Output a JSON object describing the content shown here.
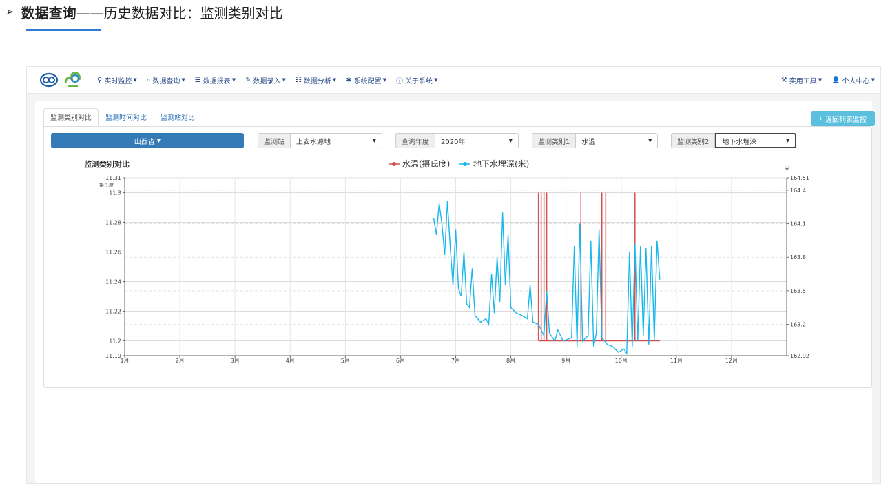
{
  "heading": {
    "arrow": "➢",
    "bold": "数据查询",
    "light": "——历史数据对比：监测类别对比"
  },
  "nav": {
    "items": [
      {
        "icon": "map-marker-icon",
        "glyph": "⚲",
        "label": "实时监控"
      },
      {
        "icon": "search-icon",
        "glyph": "⌕",
        "label": "数据查询"
      },
      {
        "icon": "list-icon",
        "glyph": "☰",
        "label": "数据报表"
      },
      {
        "icon": "edit-icon",
        "glyph": "✎",
        "label": "数据录入"
      },
      {
        "icon": "analysis-icon",
        "glyph": "☷",
        "label": "数据分析"
      },
      {
        "icon": "gear-icon",
        "glyph": "✱",
        "label": "系统配置"
      },
      {
        "icon": "info-icon",
        "glyph": "ⓘ",
        "label": "关于系统"
      }
    ],
    "right": [
      {
        "icon": "wrench-icon",
        "glyph": "⚒",
        "label": "实用工具"
      },
      {
        "icon": "user-icon",
        "glyph": "👤",
        "label": "个人中心"
      }
    ]
  },
  "tabs": [
    "监测类别对比",
    "监测时间对比",
    "监测站对比"
  ],
  "back_button": "返回列表监控",
  "province": "山西省",
  "filters": [
    {
      "label": "监测站",
      "value": "上安水源地"
    },
    {
      "label": "查询年度",
      "value": "2020年"
    },
    {
      "label": "监测类别1",
      "value": "水温"
    },
    {
      "label": "监测类别2",
      "value": "地下水埋深"
    }
  ],
  "colors": {
    "accent": "#337ab7",
    "water_temp": "#d05050",
    "depth": "#19b8ec",
    "back_btn": "#5bc0de"
  },
  "chart_data": {
    "type": "line",
    "title": "监测类别对比",
    "legend": [
      "水温(摄氏度)",
      "地下水埋深(米)"
    ],
    "legend_position": "top-center",
    "ylabel_left": "摄氏度",
    "ylabel_right": "米",
    "x_ticks": [
      "1月",
      "2月",
      "3月",
      "4月",
      "5月",
      "6月",
      "7月",
      "8月",
      "9月",
      "10月",
      "11月",
      "12月"
    ],
    "y_left_ticks": [
      "11.31",
      "11.3",
      "11.28",
      "11.26",
      "11.24",
      "11.22",
      "11.2",
      "11.19"
    ],
    "y_right_ticks": [
      "164.51",
      "164.4",
      "164.1",
      "163.8",
      "163.5",
      "163.2",
      "162.92"
    ],
    "ylim_left": [
      11.19,
      11.31
    ],
    "ylim_right": [
      162.92,
      164.51
    ],
    "grid": true,
    "series": [
      {
        "name": "水温(摄氏度)",
        "baseline": 11.2,
        "range_months": [
          8.5,
          10.7
        ],
        "spikes_month": [
          8.5,
          8.55,
          8.6,
          8.65,
          9.27,
          9.65,
          9.72,
          10.25
        ],
        "spike_value": 11.3
      },
      {
        "name": "地下水埋深(米)",
        "points": [
          [
            6.6,
            164.15
          ],
          [
            6.65,
            164.0
          ],
          [
            6.7,
            164.28
          ],
          [
            6.75,
            164.1
          ],
          [
            6.8,
            163.82
          ],
          [
            6.85,
            164.3
          ],
          [
            6.9,
            163.9
          ],
          [
            6.95,
            163.55
          ],
          [
            7.0,
            164.05
          ],
          [
            7.05,
            163.52
          ],
          [
            7.1,
            163.45
          ],
          [
            7.15,
            163.85
          ],
          [
            7.2,
            163.38
          ],
          [
            7.25,
            163.35
          ],
          [
            7.3,
            163.7
          ],
          [
            7.35,
            163.28
          ],
          [
            7.45,
            163.22
          ],
          [
            7.55,
            163.25
          ],
          [
            7.6,
            163.2
          ],
          [
            7.65,
            163.65
          ],
          [
            7.7,
            163.3
          ],
          [
            7.75,
            163.8
          ],
          [
            7.8,
            163.4
          ],
          [
            7.85,
            164.2
          ],
          [
            7.9,
            163.55
          ],
          [
            7.95,
            164.0
          ],
          [
            8.0,
            163.35
          ],
          [
            8.1,
            163.3
          ],
          [
            8.2,
            163.28
          ],
          [
            8.3,
            163.25
          ],
          [
            8.35,
            163.55
          ],
          [
            8.4,
            163.22
          ],
          [
            8.5,
            163.2
          ],
          [
            8.6,
            163.1
          ],
          [
            8.65,
            163.5
          ],
          [
            8.7,
            163.12
          ],
          [
            8.8,
            163.05
          ],
          [
            8.85,
            163.15
          ],
          [
            8.95,
            163.05
          ],
          [
            9.1,
            163.08
          ],
          [
            9.15,
            163.9
          ],
          [
            9.2,
            163.0
          ],
          [
            9.25,
            164.1
          ],
          [
            9.3,
            163.05
          ],
          [
            9.4,
            163.1
          ],
          [
            9.45,
            163.95
          ],
          [
            9.5,
            163.0
          ],
          [
            9.55,
            163.12
          ],
          [
            9.6,
            164.05
          ],
          [
            9.65,
            163.08
          ],
          [
            9.75,
            163.02
          ],
          [
            9.85,
            163.0
          ],
          [
            9.95,
            162.95
          ],
          [
            10.05,
            162.98
          ],
          [
            10.1,
            162.94
          ],
          [
            10.15,
            163.85
          ],
          [
            10.2,
            163.0
          ],
          [
            10.25,
            163.92
          ],
          [
            10.3,
            163.05
          ],
          [
            10.35,
            163.9
          ],
          [
            10.4,
            163.1
          ],
          [
            10.45,
            163.88
          ],
          [
            10.5,
            163.02
          ],
          [
            10.55,
            163.9
          ],
          [
            10.6,
            163.05
          ],
          [
            10.65,
            163.95
          ],
          [
            10.7,
            163.6
          ]
        ]
      }
    ]
  }
}
